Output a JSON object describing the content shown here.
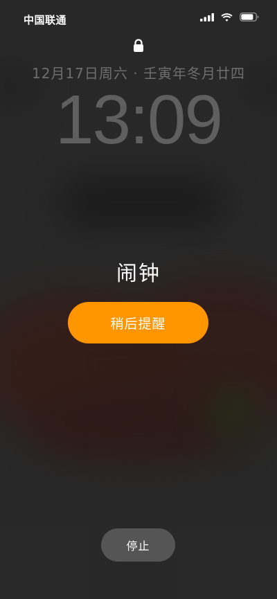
{
  "status_bar": {
    "carrier": "中国联通",
    "signal_icon": "cellular-signal-icon",
    "wifi_icon": "wifi-icon",
    "battery_icon": "battery-icon"
  },
  "lock_screen": {
    "lock_icon": "lock-icon",
    "date": "12月17日周六 · 壬寅年冬月廿四",
    "time": "13:09"
  },
  "alarm": {
    "title": "闹钟",
    "snooze_label": "稍后提醒",
    "stop_label": "停止"
  },
  "colors": {
    "snooze_button": "#ff9500",
    "stop_button": "#555555",
    "background": "#2a2a2a"
  }
}
